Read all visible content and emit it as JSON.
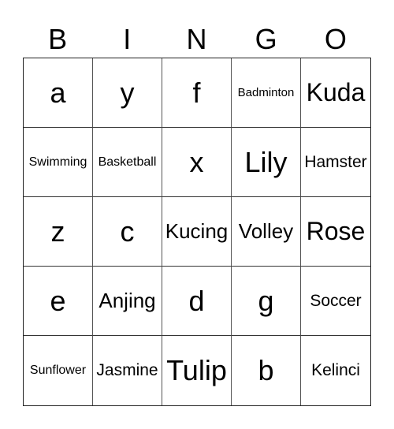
{
  "header": {
    "letters": [
      "B",
      "I",
      "N",
      "G",
      "O"
    ]
  },
  "board": {
    "rows": [
      [
        "a",
        "y",
        "f",
        "Badminton",
        "Kuda"
      ],
      [
        "Swimming",
        "Basketball",
        "x",
        "Lily",
        "Hamster"
      ],
      [
        "z",
        "c",
        "Kucing",
        "Volley",
        "Rose"
      ],
      [
        "e",
        "Anjing",
        "d",
        "g",
        "Soccer"
      ],
      [
        "Sunflower",
        "Jasmine",
        "Tulip",
        "b",
        "Kelinci"
      ]
    ]
  }
}
